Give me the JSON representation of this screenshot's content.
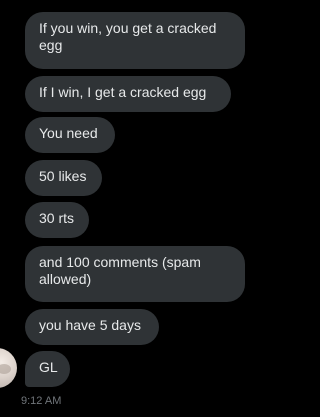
{
  "conversation": {
    "messages": [
      {
        "text": "If you win, you get a cracked egg"
      },
      {
        "text": "If I win, I get a cracked egg"
      },
      {
        "text": "You need"
      },
      {
        "text": "50 likes"
      },
      {
        "text": "30 rts"
      },
      {
        "text": "and 100 comments (spam allowed)"
      },
      {
        "text": "you have 5 days"
      },
      {
        "text": "GL"
      }
    ],
    "timestamp": "9:12 AM"
  },
  "colors": {
    "background": "#000000",
    "bubble": "#2f3336",
    "text": "#e7e9ea",
    "timestamp": "#71767b"
  }
}
